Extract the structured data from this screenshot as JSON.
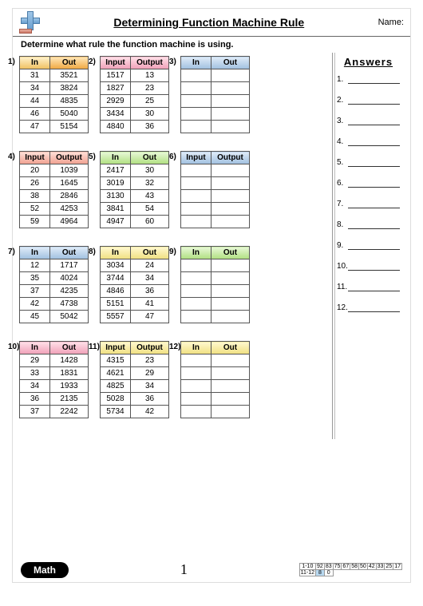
{
  "header": {
    "title": "Determining Function Machine Rule",
    "name_label": "Name:"
  },
  "instruction": "Determine what rule the function machine is using.",
  "answers": {
    "heading": "Answers",
    "count": 12
  },
  "footer": {
    "branding": "Math",
    "page": "1",
    "score": {
      "rows": [
        {
          "label": "1-10",
          "cells": [
            "92",
            "83",
            "75",
            "67",
            "58",
            "50",
            "42",
            "33",
            "25",
            "17"
          ]
        },
        {
          "label": "11-12",
          "cells": [
            "8",
            "0"
          ]
        }
      ]
    }
  },
  "tables": [
    {
      "num": "1)",
      "color": "c-orange",
      "h1": "In",
      "h2": "Out",
      "rows": [
        [
          "31",
          "3521"
        ],
        [
          "34",
          "3824"
        ],
        [
          "44",
          "4835"
        ],
        [
          "46",
          "5040"
        ],
        [
          "47",
          "5154"
        ]
      ]
    },
    {
      "num": "2)",
      "color": "c-pink",
      "h1": "Input",
      "h2": "Output",
      "rows": [
        [
          "1517",
          "13"
        ],
        [
          "1827",
          "23"
        ],
        [
          "2929",
          "25"
        ],
        [
          "3434",
          "30"
        ],
        [
          "4840",
          "36"
        ]
      ]
    },
    {
      "num": "3)",
      "color": "c-blue",
      "h1": "In",
      "h2": "Out",
      "rows": [
        [
          "",
          ""
        ],
        [
          "",
          ""
        ],
        [
          "",
          ""
        ],
        [
          "",
          ""
        ],
        [
          "",
          ""
        ]
      ]
    },
    {
      "num": "4)",
      "color": "c-red",
      "h1": "Input",
      "h2": "Output",
      "rows": [
        [
          "20",
          "1039"
        ],
        [
          "26",
          "1645"
        ],
        [
          "38",
          "2846"
        ],
        [
          "52",
          "4253"
        ],
        [
          "59",
          "4964"
        ]
      ]
    },
    {
      "num": "5)",
      "color": "c-green",
      "h1": "In",
      "h2": "Out",
      "rows": [
        [
          "2417",
          "30"
        ],
        [
          "3019",
          "32"
        ],
        [
          "3130",
          "43"
        ],
        [
          "3841",
          "54"
        ],
        [
          "4947",
          "60"
        ]
      ]
    },
    {
      "num": "6)",
      "color": "c-blue",
      "h1": "Input",
      "h2": "Output",
      "rows": [
        [
          "",
          ""
        ],
        [
          "",
          ""
        ],
        [
          "",
          ""
        ],
        [
          "",
          ""
        ],
        [
          "",
          ""
        ]
      ]
    },
    {
      "num": "7)",
      "color": "c-blue",
      "h1": "In",
      "h2": "Out",
      "rows": [
        [
          "12",
          "1717"
        ],
        [
          "35",
          "4024"
        ],
        [
          "37",
          "4235"
        ],
        [
          "42",
          "4738"
        ],
        [
          "45",
          "5042"
        ]
      ]
    },
    {
      "num": "8)",
      "color": "c-yellow",
      "h1": "In",
      "h2": "Out",
      "rows": [
        [
          "3034",
          "24"
        ],
        [
          "3744",
          "34"
        ],
        [
          "4846",
          "36"
        ],
        [
          "5151",
          "41"
        ],
        [
          "5557",
          "47"
        ]
      ]
    },
    {
      "num": "9)",
      "color": "c-green",
      "h1": "In",
      "h2": "Out",
      "rows": [
        [
          "",
          ""
        ],
        [
          "",
          ""
        ],
        [
          "",
          ""
        ],
        [
          "",
          ""
        ],
        [
          "",
          ""
        ]
      ]
    },
    {
      "num": "10)",
      "color": "c-pink",
      "h1": "In",
      "h2": "Out",
      "rows": [
        [
          "29",
          "1428"
        ],
        [
          "33",
          "1831"
        ],
        [
          "34",
          "1933"
        ],
        [
          "36",
          "2135"
        ],
        [
          "37",
          "2242"
        ]
      ]
    },
    {
      "num": "11)",
      "color": "c-yellow",
      "h1": "Input",
      "h2": "Output",
      "rows": [
        [
          "4315",
          "23"
        ],
        [
          "4621",
          "29"
        ],
        [
          "4825",
          "34"
        ],
        [
          "5028",
          "36"
        ],
        [
          "5734",
          "42"
        ]
      ]
    },
    {
      "num": "12)",
      "color": "c-yellow",
      "h1": "In",
      "h2": "Out",
      "rows": [
        [
          "",
          ""
        ],
        [
          "",
          ""
        ],
        [
          "",
          ""
        ],
        [
          "",
          ""
        ],
        [
          "",
          ""
        ]
      ]
    }
  ]
}
